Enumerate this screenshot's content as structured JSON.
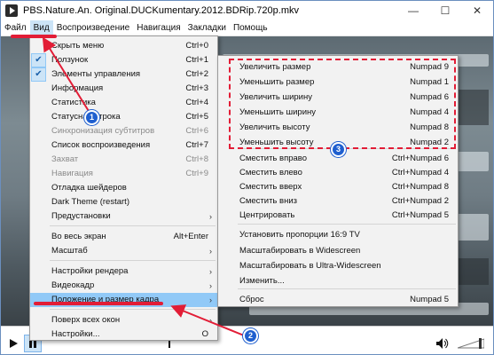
{
  "window": {
    "title": "PBS.Nature.An. Original.DUCKumentary.2012.BDRip.720p.mkv",
    "controls": {
      "minimize": "—",
      "maximize": "☐",
      "close": "✕"
    }
  },
  "menubar": [
    "Файл",
    "Вид",
    "Воспроизведение",
    "Навигация",
    "Закладки",
    "Помощь"
  ],
  "view_menu": [
    {
      "label": "Скрыть меню",
      "shortcut": "Ctrl+0"
    },
    {
      "label": "Ползунок",
      "shortcut": "Ctrl+1",
      "checked": true
    },
    {
      "label": "Элементы управления",
      "shortcut": "Ctrl+2",
      "checked": true
    },
    {
      "label": "Информация",
      "shortcut": "Ctrl+3"
    },
    {
      "label": "Статистика",
      "shortcut": "Ctrl+4"
    },
    {
      "label": "Статусная строка",
      "shortcut": "Ctrl+5"
    },
    {
      "label": "Синхронизация субтитров",
      "shortcut": "Ctrl+6",
      "disabled": true
    },
    {
      "label": "Список воспроизведения",
      "shortcut": "Ctrl+7"
    },
    {
      "label": "Захват",
      "shortcut": "Ctrl+8",
      "disabled": true
    },
    {
      "label": "Навигация",
      "shortcut": "Ctrl+9",
      "disabled": true
    },
    {
      "label": "Отладка шейдеров",
      "shortcut": ""
    },
    {
      "label": "Dark Theme (restart)",
      "shortcut": ""
    },
    {
      "label": "Предустановки",
      "submenu": true
    },
    {
      "label": "Во весь экран",
      "shortcut": "Alt+Enter"
    },
    {
      "label": "Масштаб",
      "submenu": true
    },
    {
      "label": "Настройки рендера",
      "submenu": true
    },
    {
      "label": "Видеокадр",
      "submenu": true
    },
    {
      "label": "Положение и размер кадра",
      "submenu": true,
      "highlighted": true
    },
    {
      "label": "Поверх всех окон",
      "submenu": true
    },
    {
      "label": "Настройки...",
      "shortcut": "O"
    }
  ],
  "submenu": [
    {
      "label": "Увеличить размер",
      "shortcut": "Numpad 9"
    },
    {
      "label": "Уменьшить размер",
      "shortcut": "Numpad 1"
    },
    {
      "label": "Увеличить ширину",
      "shortcut": "Numpad 6"
    },
    {
      "label": "Уменьшить ширину",
      "shortcut": "Numpad 4"
    },
    {
      "label": "Увеличить высоту",
      "shortcut": "Numpad 8"
    },
    {
      "label": "Уменьшить высоту",
      "shortcut": "Numpad 2"
    },
    {
      "label": "Сместить вправо",
      "shortcut": "Ctrl+Numpad 6"
    },
    {
      "label": "Сместить влево",
      "shortcut": "Ctrl+Numpad 4"
    },
    {
      "label": "Сместить вверх",
      "shortcut": "Ctrl+Numpad 8"
    },
    {
      "label": "Сместить вниз",
      "shortcut": "Ctrl+Numpad 2"
    },
    {
      "label": "Центрировать",
      "shortcut": "Ctrl+Numpad 5"
    },
    {
      "label": "Установить пропорции 16:9 TV",
      "shortcut": ""
    },
    {
      "label": "Масштабировать в Widescreen",
      "shortcut": ""
    },
    {
      "label": "Масштабировать в Ultra-Widescreen",
      "shortcut": ""
    },
    {
      "label": "Изменить...",
      "shortcut": ""
    },
    {
      "label": "Сброс",
      "shortcut": "Numpad 5"
    }
  ],
  "annotations": {
    "badge1": "1",
    "badge2": "2",
    "badge3": "3",
    "color": "#e21d36",
    "badge_color": "#1f5fcf"
  },
  "icons": {
    "check": "✔",
    "submenu_arrow": "›"
  }
}
